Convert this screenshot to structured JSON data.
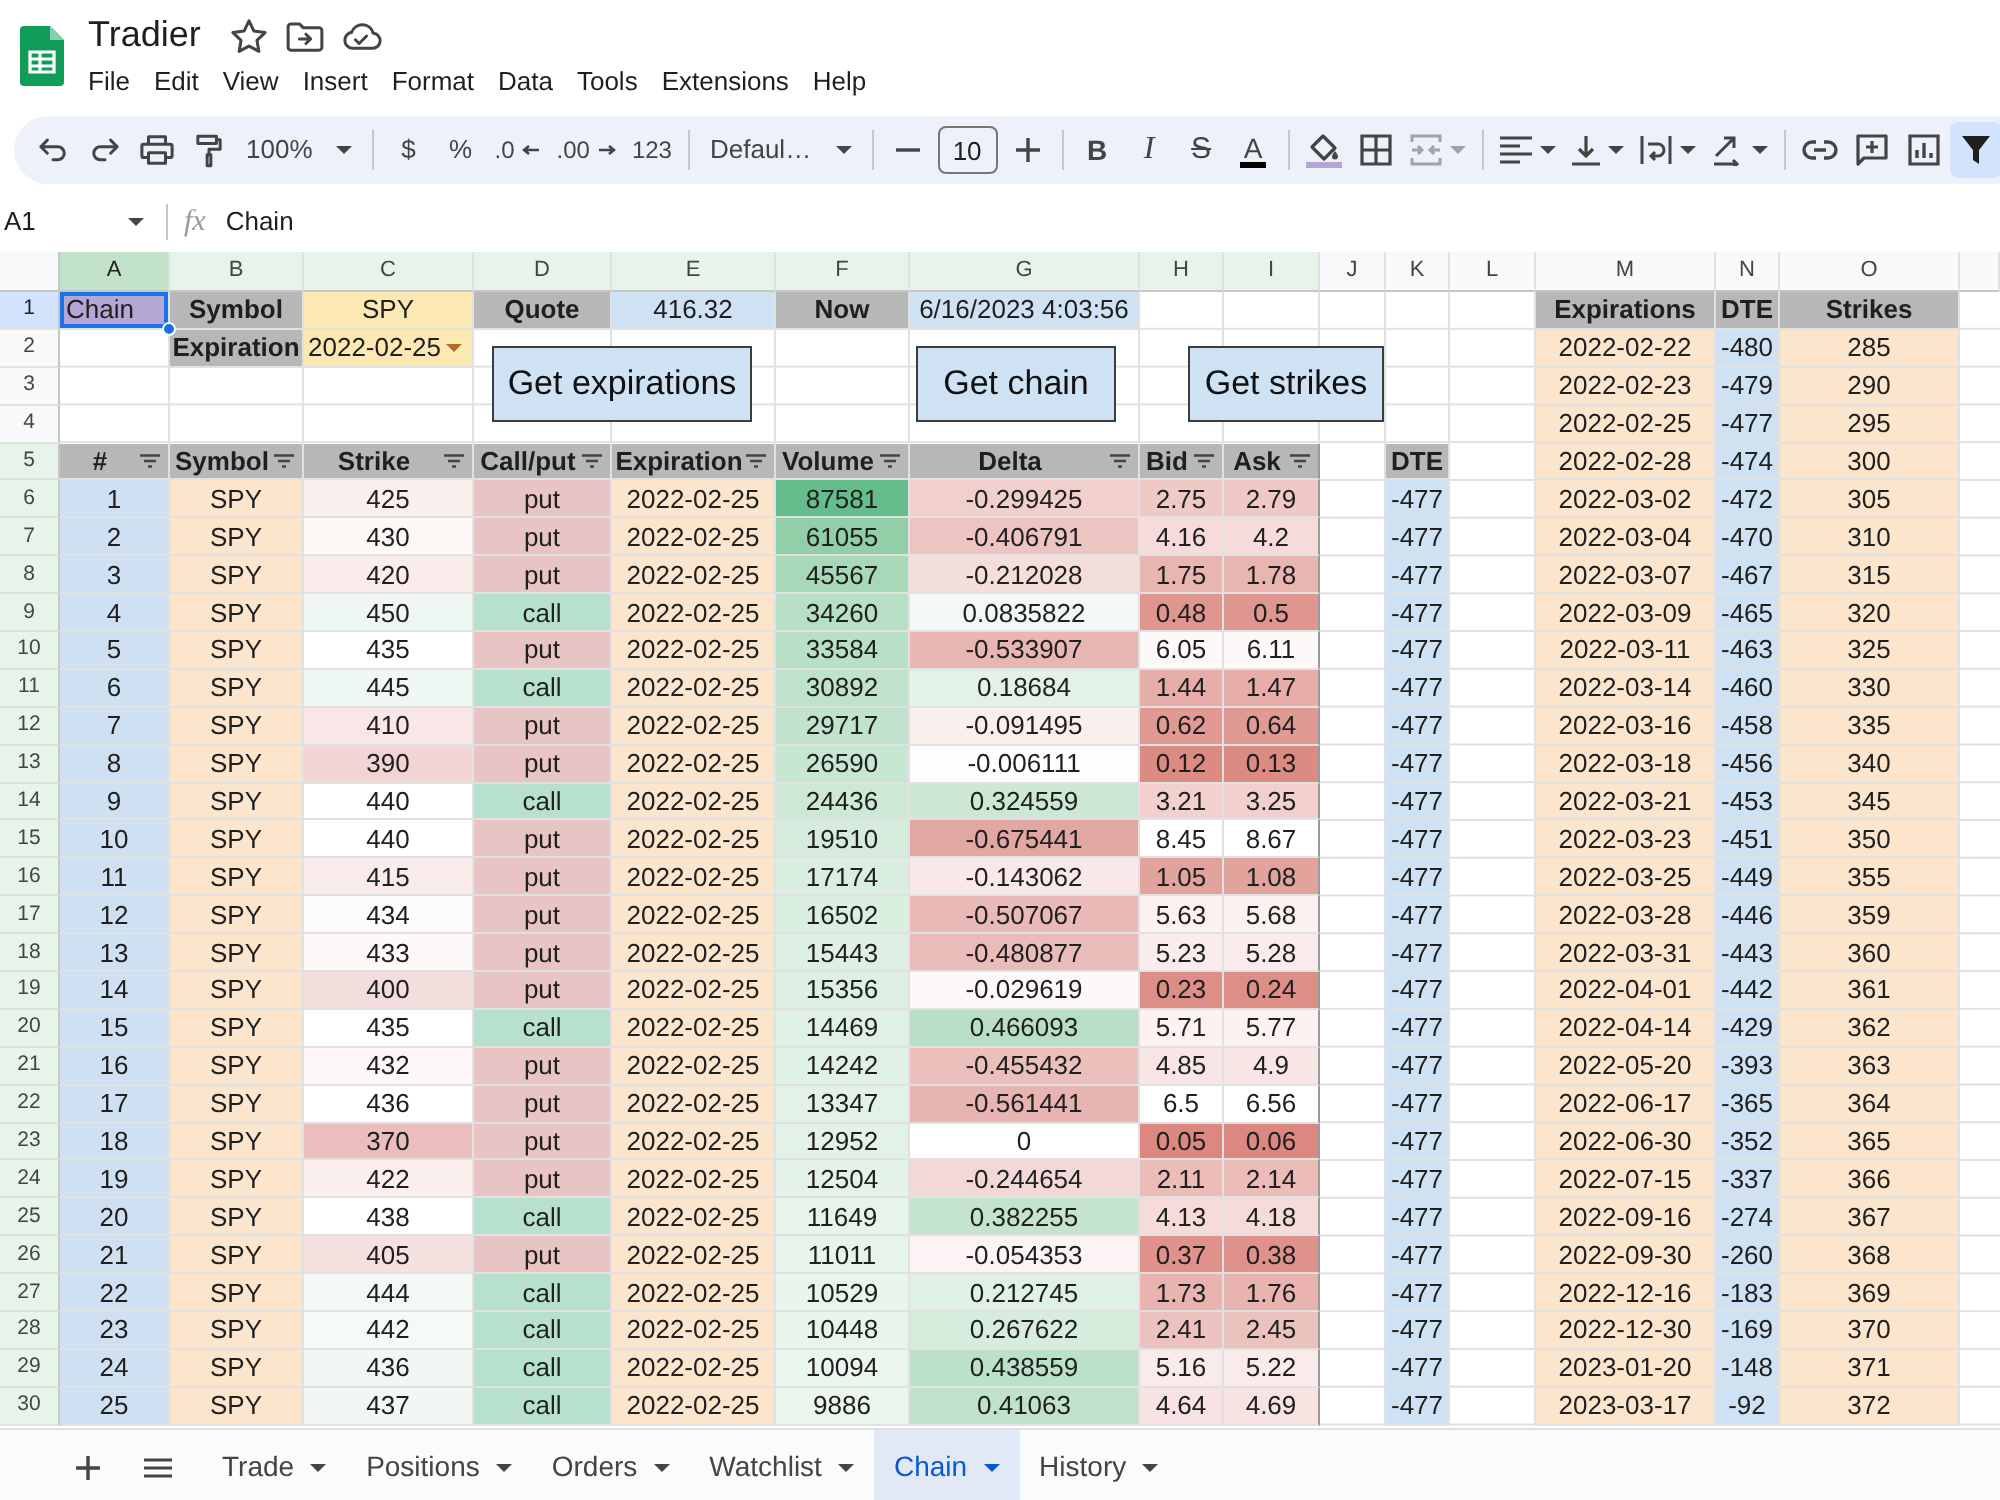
{
  "document": {
    "title": "Tradier"
  },
  "menu": [
    "File",
    "Edit",
    "View",
    "Insert",
    "Format",
    "Data",
    "Tools",
    "Extensions",
    "Help"
  ],
  "toolbar": {
    "zoom": "100%",
    "currency": "$",
    "percent": "%",
    "decrease_decimal": ".0",
    "increase_decimal": ".00",
    "number_format": "123",
    "font": "Defaul…",
    "font_size": "10",
    "bold": "B",
    "italic": "I",
    "strikethrough": "S",
    "text_color": "A",
    "merge_disabled": true,
    "filter_active": true
  },
  "formula_bar": {
    "cell_ref": "A1",
    "fx": "fx",
    "content": "Chain"
  },
  "sheet": {
    "columns": [
      {
        "label": "A",
        "selected": true,
        "filtered": true
      },
      {
        "label": "B",
        "selected": false,
        "filtered": true
      },
      {
        "label": "C",
        "selected": false,
        "filtered": true
      },
      {
        "label": "D",
        "selected": false,
        "filtered": true
      },
      {
        "label": "E",
        "selected": false,
        "filtered": true
      },
      {
        "label": "F",
        "selected": false,
        "filtered": true
      },
      {
        "label": "G",
        "selected": false,
        "filtered": true
      },
      {
        "label": "H",
        "selected": false,
        "filtered": true
      },
      {
        "label": "I",
        "selected": false,
        "filtered": true
      },
      {
        "label": "J",
        "selected": false,
        "filtered": false
      },
      {
        "label": "K",
        "selected": false,
        "filtered": false
      },
      {
        "label": "L",
        "selected": false,
        "filtered": false
      },
      {
        "label": "M",
        "selected": false,
        "filtered": false
      },
      {
        "label": "N",
        "selected": false,
        "filtered": false
      },
      {
        "label": "O",
        "selected": false,
        "filtered": false
      }
    ],
    "row_numbers": [
      {
        "label": "1",
        "selected": true,
        "filtered": false
      },
      {
        "label": "2",
        "selected": false,
        "filtered": false
      },
      {
        "label": "3",
        "selected": false,
        "filtered": false
      },
      {
        "label": "4",
        "selected": false,
        "filtered": false
      },
      {
        "label": "5",
        "selected": false,
        "filtered": true
      },
      {
        "label": "6",
        "selected": false,
        "filtered": true
      },
      {
        "label": "7",
        "selected": false,
        "filtered": true
      },
      {
        "label": "8",
        "selected": false,
        "filtered": true
      },
      {
        "label": "9",
        "selected": false,
        "filtered": true
      },
      {
        "label": "10",
        "selected": false,
        "filtered": true
      },
      {
        "label": "11",
        "selected": false,
        "filtered": true
      },
      {
        "label": "12",
        "selected": false,
        "filtered": true
      },
      {
        "label": "13",
        "selected": false,
        "filtered": true
      },
      {
        "label": "14",
        "selected": false,
        "filtered": true
      },
      {
        "label": "15",
        "selected": false,
        "filtered": true
      },
      {
        "label": "16",
        "selected": false,
        "filtered": true
      },
      {
        "label": "17",
        "selected": false,
        "filtered": true
      },
      {
        "label": "18",
        "selected": false,
        "filtered": true
      },
      {
        "label": "19",
        "selected": false,
        "filtered": true
      },
      {
        "label": "20",
        "selected": false,
        "filtered": true
      },
      {
        "label": "21",
        "selected": false,
        "filtered": true
      },
      {
        "label": "22",
        "selected": false,
        "filtered": true
      },
      {
        "label": "23",
        "selected": false,
        "filtered": true
      },
      {
        "label": "24",
        "selected": false,
        "filtered": true
      },
      {
        "label": "25",
        "selected": false,
        "filtered": true
      },
      {
        "label": "26",
        "selected": false,
        "filtered": true
      },
      {
        "label": "27",
        "selected": false,
        "filtered": true
      },
      {
        "label": "28",
        "selected": false,
        "filtered": true
      },
      {
        "label": "29",
        "selected": false,
        "filtered": true
      },
      {
        "label": "30",
        "selected": false,
        "filtered": true
      }
    ],
    "a1": "Chain"
  },
  "params": {
    "symbol_label": "Symbol",
    "symbol": "SPY",
    "quote_label": "Quote",
    "quote": "416.32",
    "now_label": "Now",
    "now": "6/16/2023 4:03:56",
    "expiration_label": "Expiration",
    "expiration": "2022-02-25"
  },
  "buttons": [
    "Get expirations",
    "Get chain",
    "Get strikes"
  ],
  "chain_table": {
    "columns": [
      "#",
      "Symbol",
      "Strike",
      "Call/put",
      "Expiration",
      "Volume",
      "Delta",
      "Bid",
      "Ask"
    ],
    "dte_header": "DTE",
    "rows": [
      {
        "number": "1",
        "symbol": "SPY",
        "strike": {
          "text": "425",
          "color": "#fbefee"
        },
        "type": {
          "text": "put",
          "color": "#e8c4c5"
        },
        "expiration": "2022-02-25",
        "volume": {
          "text": "87581",
          "color": "#65bd8c"
        },
        "delta": {
          "text": "-0.299425",
          "color": "#f0cfcd"
        },
        "bid": {
          "text": "2.75",
          "color": "#efc9c6"
        },
        "ask": {
          "text": "2.79",
          "color": "#efc9c6"
        },
        "dte": "-477"
      },
      {
        "number": "2",
        "symbol": "SPY",
        "strike": {
          "text": "430",
          "color": "#fdf7f6"
        },
        "type": {
          "text": "put",
          "color": "#e8c4c5"
        },
        "expiration": "2022-02-25",
        "volume": {
          "text": "61055",
          "color": "#92cfa9"
        },
        "delta": {
          "text": "-0.406791",
          "color": "#ecc4c2"
        },
        "bid": {
          "text": "4.16",
          "color": "#f5dcda"
        },
        "ask": {
          "text": "4.2",
          "color": "#f5dcda"
        },
        "dte": "-477"
      },
      {
        "number": "3",
        "symbol": "SPY",
        "strike": {
          "text": "420",
          "color": "#faeceb"
        },
        "type": {
          "text": "put",
          "color": "#e8c4c5"
        },
        "expiration": "2022-02-25",
        "volume": {
          "text": "45567",
          "color": "#a7d8b8"
        },
        "delta": {
          "text": "-0.212028",
          "color": "#f4dedc"
        },
        "bid": {
          "text": "1.75",
          "color": "#e9b5b1"
        },
        "ask": {
          "text": "1.78",
          "color": "#e9b5b1"
        },
        "dte": "-477"
      },
      {
        "number": "4",
        "symbol": "SPY",
        "strike": {
          "text": "450",
          "color": "#eff7f2"
        },
        "type": {
          "text": "call",
          "color": "#b7e1cd"
        },
        "expiration": "2022-02-25",
        "volume": {
          "text": "34260",
          "color": "#b7dfc5"
        },
        "delta": {
          "text": "0.0835822",
          "color": "#f2f9f4"
        },
        "bid": {
          "text": "0.48",
          "color": "#df968f"
        },
        "ask": {
          "text": "0.5",
          "color": "#df968f"
        },
        "dte": "-477"
      },
      {
        "number": "5",
        "symbol": "SPY",
        "strike": {
          "text": "435",
          "color": "#ffffff"
        },
        "type": {
          "text": "put",
          "color": "#e8c4c5"
        },
        "expiration": "2022-02-25",
        "volume": {
          "text": "33584",
          "color": "#b8e0c6"
        },
        "delta": {
          "text": "-0.533907",
          "color": "#e8b7b4"
        },
        "bid": {
          "text": "6.05",
          "color": "#fdf9f8"
        },
        "ask": {
          "text": "6.11",
          "color": "#fdf9f8"
        },
        "dte": "-477"
      },
      {
        "number": "6",
        "symbol": "SPY",
        "strike": {
          "text": "445",
          "color": "#f0f8f3"
        },
        "type": {
          "text": "call",
          "color": "#b7e1cd"
        },
        "expiration": "2022-02-25",
        "volume": {
          "text": "30892",
          "color": "#bee2cb"
        },
        "delta": {
          "text": "0.18684",
          "color": "#e3f2e8"
        },
        "bid": {
          "text": "1.44",
          "color": "#e7aea9"
        },
        "ask": {
          "text": "1.47",
          "color": "#e7aea9"
        },
        "dte": "-477"
      },
      {
        "number": "7",
        "symbol": "SPY",
        "strike": {
          "text": "410",
          "color": "#f8e7e6"
        },
        "type": {
          "text": "put",
          "color": "#e8c4c5"
        },
        "expiration": "2022-02-25",
        "volume": {
          "text": "29717",
          "color": "#c1e3cd"
        },
        "delta": {
          "text": "-0.091495",
          "color": "#fbefee"
        },
        "bid": {
          "text": "0.62",
          "color": "#e09a93"
        },
        "ask": {
          "text": "0.64",
          "color": "#e09a93"
        },
        "dte": "-477"
      },
      {
        "number": "8",
        "symbol": "SPY",
        "strike": {
          "text": "390",
          "color": "#f1d4d3"
        },
        "type": {
          "text": "put",
          "color": "#e8c4c5"
        },
        "expiration": "2022-02-25",
        "volume": {
          "text": "26590",
          "color": "#c8e7d2"
        },
        "delta": {
          "text": "-0.006111",
          "color": "#fffefe"
        },
        "bid": {
          "text": "0.12",
          "color": "#dc8b83"
        },
        "ask": {
          "text": "0.13",
          "color": "#dc8b83"
        },
        "dte": "-477"
      },
      {
        "number": "9",
        "symbol": "SPY",
        "strike": {
          "text": "440",
          "color": "#ffffff"
        },
        "type": {
          "text": "call",
          "color": "#b7e1cd"
        },
        "expiration": "2022-02-25",
        "volume": {
          "text": "24436",
          "color": "#cde9d6"
        },
        "delta": {
          "text": "0.324559",
          "color": "#cce8d5"
        },
        "bid": {
          "text": "3.21",
          "color": "#f1d0cd"
        },
        "ask": {
          "text": "3.25",
          "color": "#f1d0cd"
        },
        "dte": "-477"
      },
      {
        "number": "10",
        "symbol": "SPY",
        "strike": {
          "text": "440",
          "color": "#ffffff"
        },
        "type": {
          "text": "put",
          "color": "#e8c4c5"
        },
        "expiration": "2022-02-25",
        "volume": {
          "text": "19510",
          "color": "#d5ecdc"
        },
        "delta": {
          "text": "-0.675441",
          "color": "#e3a7a3"
        },
        "bid": {
          "text": "8.45",
          "color": "#ffffff"
        },
        "ask": {
          "text": "8.67",
          "color": "#ffffff"
        },
        "dte": "-477"
      },
      {
        "number": "11",
        "symbol": "SPY",
        "strike": {
          "text": "415",
          "color": "#f9ebea"
        },
        "type": {
          "text": "put",
          "color": "#e8c4c5"
        },
        "expiration": "2022-02-25",
        "volume": {
          "text": "17174",
          "color": "#d9eedf"
        },
        "delta": {
          "text": "-0.143062",
          "color": "#f8e8e7"
        },
        "bid": {
          "text": "1.05",
          "color": "#e3a39d"
        },
        "ask": {
          "text": "1.08",
          "color": "#e3a39d"
        },
        "dte": "-477"
      },
      {
        "number": "12",
        "symbol": "SPY",
        "strike": {
          "text": "434",
          "color": "#fefbfb"
        },
        "type": {
          "text": "put",
          "color": "#e8c4c5"
        },
        "expiration": "2022-02-25",
        "volume": {
          "text": "16502",
          "color": "#dbefe1"
        },
        "delta": {
          "text": "-0.507067",
          "color": "#e9bab7"
        },
        "bid": {
          "text": "5.63",
          "color": "#fbf1f0"
        },
        "ask": {
          "text": "5.68",
          "color": "#fbf1f0"
        },
        "dte": "-477"
      },
      {
        "number": "13",
        "symbol": "SPY",
        "strike": {
          "text": "433",
          "color": "#fdf9f9"
        },
        "type": {
          "text": "put",
          "color": "#e8c4c5"
        },
        "expiration": "2022-02-25",
        "volume": {
          "text": "15443",
          "color": "#ddf0e3"
        },
        "delta": {
          "text": "-0.480877",
          "color": "#eabcb9"
        },
        "bid": {
          "text": "5.23",
          "color": "#f9ecea"
        },
        "ask": {
          "text": "5.28",
          "color": "#f9ecea"
        },
        "dte": "-477"
      },
      {
        "number": "14",
        "symbol": "SPY",
        "strike": {
          "text": "400",
          "color": "#f4dedd"
        },
        "type": {
          "text": "put",
          "color": "#e8c4c5"
        },
        "expiration": "2022-02-25",
        "volume": {
          "text": "15356",
          "color": "#ddf0e3"
        },
        "delta": {
          "text": "-0.029619",
          "color": "#fdf9f9"
        },
        "bid": {
          "text": "0.23",
          "color": "#dd8f87"
        },
        "ask": {
          "text": "0.24",
          "color": "#dd8f87"
        },
        "dte": "-477"
      },
      {
        "number": "15",
        "symbol": "SPY",
        "strike": {
          "text": "435",
          "color": "#ffffff"
        },
        "type": {
          "text": "call",
          "color": "#b7e1cd"
        },
        "expiration": "2022-02-25",
        "volume": {
          "text": "14469",
          "color": "#dff1e5"
        },
        "delta": {
          "text": "0.466093",
          "color": "#b8dfc6"
        },
        "bid": {
          "text": "5.71",
          "color": "#fbf2f1"
        },
        "ask": {
          "text": "5.77",
          "color": "#fbf2f1"
        },
        "dte": "-477"
      },
      {
        "number": "16",
        "symbol": "SPY",
        "strike": {
          "text": "432",
          "color": "#fdf8f7"
        },
        "type": {
          "text": "put",
          "color": "#e8c4c5"
        },
        "expiration": "2022-02-25",
        "volume": {
          "text": "14242",
          "color": "#e0f1e5"
        },
        "delta": {
          "text": "-0.455432",
          "color": "#ebbfbc"
        },
        "bid": {
          "text": "4.85",
          "color": "#f7e6e4"
        },
        "ask": {
          "text": "4.9",
          "color": "#f7e6e4"
        },
        "dte": "-477"
      },
      {
        "number": "17",
        "symbol": "SPY",
        "strike": {
          "text": "436",
          "color": "#ffffff"
        },
        "type": {
          "text": "put",
          "color": "#e8c4c5"
        },
        "expiration": "2022-02-25",
        "volume": {
          "text": "13347",
          "color": "#e2f2e7"
        },
        "delta": {
          "text": "-0.561441",
          "color": "#e7b4b1"
        },
        "bid": {
          "text": "6.5",
          "color": "#ffffff"
        },
        "ask": {
          "text": "6.56",
          "color": "#ffffff"
        },
        "dte": "-477"
      },
      {
        "number": "18",
        "symbol": "SPY",
        "strike": {
          "text": "370",
          "color": "#e9bebd"
        },
        "type": {
          "text": "put",
          "color": "#e8c4c5"
        },
        "expiration": "2022-02-25",
        "volume": {
          "text": "12952",
          "color": "#e3f2e8"
        },
        "delta": {
          "text": "0",
          "color": "#ffffff"
        },
        "bid": {
          "text": "0.05",
          "color": "#dc8880"
        },
        "ask": {
          "text": "0.06",
          "color": "#dc8880"
        },
        "dte": "-477"
      },
      {
        "number": "19",
        "symbol": "SPY",
        "strike": {
          "text": "422",
          "color": "#fbefee"
        },
        "type": {
          "text": "put",
          "color": "#e8c4c5"
        },
        "expiration": "2022-02-25",
        "volume": {
          "text": "12504",
          "color": "#e4f3e9"
        },
        "delta": {
          "text": "-0.244654",
          "color": "#f2d9d7"
        },
        "bid": {
          "text": "2.11",
          "color": "#ebbcb8"
        },
        "ask": {
          "text": "2.14",
          "color": "#ebbcb8"
        },
        "dte": "-477"
      },
      {
        "number": "20",
        "symbol": "SPY",
        "strike": {
          "text": "438",
          "color": "#ffffff"
        },
        "type": {
          "text": "call",
          "color": "#b7e1cd"
        },
        "expiration": "2022-02-25",
        "volume": {
          "text": "11649",
          "color": "#e6f4ea"
        },
        "delta": {
          "text": "0.382255",
          "color": "#c4e4ce"
        },
        "bid": {
          "text": "4.13",
          "color": "#f5dbd9"
        },
        "ask": {
          "text": "4.18",
          "color": "#f5dbd9"
        },
        "dte": "-477"
      },
      {
        "number": "21",
        "symbol": "SPY",
        "strike": {
          "text": "405",
          "color": "#f5e1e0"
        },
        "type": {
          "text": "put",
          "color": "#e8c4c5"
        },
        "expiration": "2022-02-25",
        "volume": {
          "text": "11011",
          "color": "#e7f4eb"
        },
        "delta": {
          "text": "-0.054353",
          "color": "#fcf4f4"
        },
        "bid": {
          "text": "0.37",
          "color": "#de928b"
        },
        "ask": {
          "text": "0.38",
          "color": "#de928b"
        },
        "dte": "-477"
      },
      {
        "number": "22",
        "symbol": "SPY",
        "strike": {
          "text": "444",
          "color": "#f3f9f5"
        },
        "type": {
          "text": "call",
          "color": "#b7e1cd"
        },
        "expiration": "2022-02-25",
        "volume": {
          "text": "10529",
          "color": "#e8f5ec"
        },
        "delta": {
          "text": "0.212745",
          "color": "#dff0e5"
        },
        "bid": {
          "text": "1.73",
          "color": "#e9b4b0"
        },
        "ask": {
          "text": "1.76",
          "color": "#e9b4b0"
        },
        "dte": "-477"
      },
      {
        "number": "23",
        "symbol": "SPY",
        "strike": {
          "text": "442",
          "color": "#f4faf6"
        },
        "type": {
          "text": "call",
          "color": "#b7e1cd"
        },
        "expiration": "2022-02-25",
        "volume": {
          "text": "10448",
          "color": "#e8f5ec"
        },
        "delta": {
          "text": "0.267622",
          "color": "#d6ecdd"
        },
        "bid": {
          "text": "2.41",
          "color": "#ecc2be"
        },
        "ask": {
          "text": "2.45",
          "color": "#ecc2be"
        },
        "dte": "-477"
      },
      {
        "number": "24",
        "symbol": "SPY",
        "strike": {
          "text": "436",
          "color": "#f1f8f3"
        },
        "type": {
          "text": "call",
          "color": "#b7e1cd"
        },
        "expiration": "2022-02-25",
        "volume": {
          "text": "10094",
          "color": "#e9f5ed"
        },
        "delta": {
          "text": "0.438559",
          "color": "#bce1c9"
        },
        "bid": {
          "text": "5.16",
          "color": "#f9ebe9"
        },
        "ask": {
          "text": "5.22",
          "color": "#f9ebe9"
        },
        "dte": "-477"
      },
      {
        "number": "25",
        "symbol": "SPY",
        "strike": {
          "text": "437",
          "color": "#f1f8f3"
        },
        "type": {
          "text": "call",
          "color": "#b7e1cd"
        },
        "expiration": "2022-02-25",
        "volume": {
          "text": "9886",
          "color": "#eaf6ee"
        },
        "delta": {
          "text": "0.41063",
          "color": "#c0e2cb"
        },
        "bid": {
          "text": "4.64",
          "color": "#f7e3e1"
        },
        "ask": {
          "text": "4.69",
          "color": "#f7e3e1"
        },
        "dte": "-477"
      }
    ]
  },
  "expirations_table": {
    "columns": [
      "Expirations",
      "DTE",
      "Strikes"
    ],
    "rows": [
      {
        "expiration": "2022-02-22",
        "dte": "-480",
        "strike": "285"
      },
      {
        "expiration": "2022-02-23",
        "dte": "-479",
        "strike": "290"
      },
      {
        "expiration": "2022-02-25",
        "dte": "-477",
        "strike": "295"
      },
      {
        "expiration": "2022-02-28",
        "dte": "-474",
        "strike": "300"
      },
      {
        "expiration": "2022-03-02",
        "dte": "-472",
        "strike": "305"
      },
      {
        "expiration": "2022-03-04",
        "dte": "-470",
        "strike": "310"
      },
      {
        "expiration": "2022-03-07",
        "dte": "-467",
        "strike": "315"
      },
      {
        "expiration": "2022-03-09",
        "dte": "-465",
        "strike": "320"
      },
      {
        "expiration": "2022-03-11",
        "dte": "-463",
        "strike": "325"
      },
      {
        "expiration": "2022-03-14",
        "dte": "-460",
        "strike": "330"
      },
      {
        "expiration": "2022-03-16",
        "dte": "-458",
        "strike": "335"
      },
      {
        "expiration": "2022-03-18",
        "dte": "-456",
        "strike": "340"
      },
      {
        "expiration": "2022-03-21",
        "dte": "-453",
        "strike": "345"
      },
      {
        "expiration": "2022-03-23",
        "dte": "-451",
        "strike": "350"
      },
      {
        "expiration": "2022-03-25",
        "dte": "-449",
        "strike": "355"
      },
      {
        "expiration": "2022-03-28",
        "dte": "-446",
        "strike": "359"
      },
      {
        "expiration": "2022-03-31",
        "dte": "-443",
        "strike": "360"
      },
      {
        "expiration": "2022-04-01",
        "dte": "-442",
        "strike": "361"
      },
      {
        "expiration": "2022-04-14",
        "dte": "-429",
        "strike": "362"
      },
      {
        "expiration": "2022-05-20",
        "dte": "-393",
        "strike": "363"
      },
      {
        "expiration": "2022-06-17",
        "dte": "-365",
        "strike": "364"
      },
      {
        "expiration": "2022-06-30",
        "dte": "-352",
        "strike": "365"
      },
      {
        "expiration": "2022-07-15",
        "dte": "-337",
        "strike": "366"
      },
      {
        "expiration": "2022-09-16",
        "dte": "-274",
        "strike": "367"
      },
      {
        "expiration": "2022-09-30",
        "dte": "-260",
        "strike": "368"
      },
      {
        "expiration": "2022-12-16",
        "dte": "-183",
        "strike": "369"
      },
      {
        "expiration": "2022-12-30",
        "dte": "-169",
        "strike": "370"
      },
      {
        "expiration": "2023-01-20",
        "dte": "-148",
        "strike": "371"
      },
      {
        "expiration": "2023-03-17",
        "dte": "-92",
        "strike": "372"
      }
    ]
  },
  "sheet_tabs": [
    {
      "label": "Trade",
      "selected": false
    },
    {
      "label": "Positions",
      "selected": false
    },
    {
      "label": "Orders",
      "selected": false
    },
    {
      "label": "Watchlist",
      "selected": false
    },
    {
      "label": "Chain",
      "selected": true
    },
    {
      "label": "History",
      "selected": false
    }
  ]
}
